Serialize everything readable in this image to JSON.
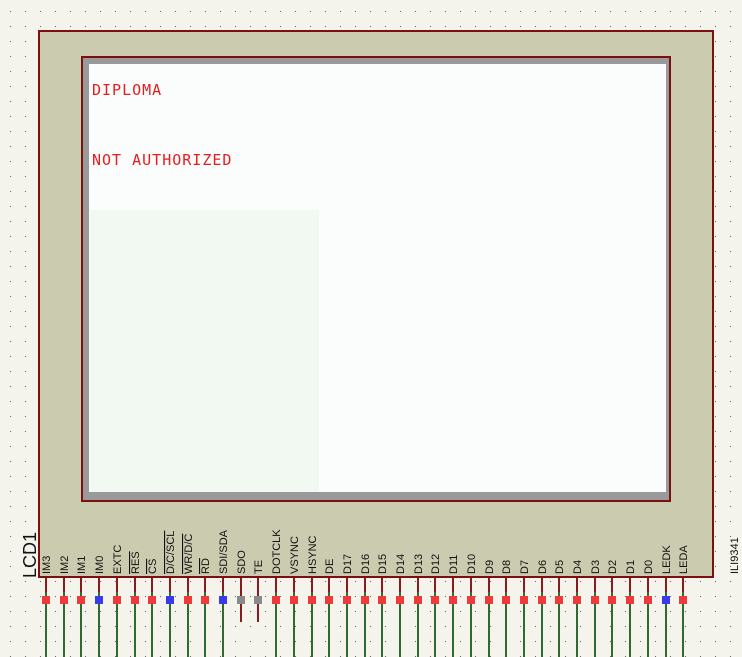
{
  "component": {
    "designator": "LCD1",
    "part_value": "ILI9341"
  },
  "display": {
    "lines": [
      "DIPLOMA",
      "NOT AUTHORIZED"
    ]
  },
  "pins": [
    {
      "name": "IM3",
      "state": "red"
    },
    {
      "name": "IM2",
      "state": "red"
    },
    {
      "name": "IM1",
      "state": "red"
    },
    {
      "name": "IM0",
      "state": "blue"
    },
    {
      "name": "EXTC",
      "state": "red"
    },
    {
      "name": "RES",
      "state": "red",
      "overline": true
    },
    {
      "name": "CS",
      "state": "red",
      "overline": true
    },
    {
      "name": "D/C/SCL",
      "state": "blue",
      "overline": true
    },
    {
      "name": "WR/D/C",
      "state": "red",
      "overline": true
    },
    {
      "name": "RD",
      "state": "red",
      "overline": true
    },
    {
      "name": "SDI/SDA",
      "state": "blue"
    },
    {
      "name": "SDO",
      "state": "gray"
    },
    {
      "name": "TE",
      "state": "gray"
    },
    {
      "name": "DOTCLK",
      "state": "red"
    },
    {
      "name": "VSYNC",
      "state": "red"
    },
    {
      "name": "HSYNC",
      "state": "red"
    },
    {
      "name": "DE",
      "state": "red"
    },
    {
      "name": "D17",
      "state": "red"
    },
    {
      "name": "D16",
      "state": "red"
    },
    {
      "name": "D15",
      "state": "red"
    },
    {
      "name": "D14",
      "state": "red"
    },
    {
      "name": "D13",
      "state": "red"
    },
    {
      "name": "D12",
      "state": "red"
    },
    {
      "name": "D11",
      "state": "red"
    },
    {
      "name": "D10",
      "state": "red"
    },
    {
      "name": "D9",
      "state": "red"
    },
    {
      "name": "D8",
      "state": "red"
    },
    {
      "name": "D7",
      "state": "red"
    },
    {
      "name": "D6",
      "state": "red"
    },
    {
      "name": "D5",
      "state": "red"
    },
    {
      "name": "D4",
      "state": "red"
    },
    {
      "name": "D3",
      "state": "red"
    },
    {
      "name": "D2",
      "state": "red"
    },
    {
      "name": "D1",
      "state": "red"
    },
    {
      "name": "D0",
      "state": "red"
    },
    {
      "name": "LEDK",
      "state": "blue"
    },
    {
      "name": "LEDA",
      "state": "red"
    }
  ],
  "colors": {
    "red": "#ee3a3a",
    "blue": "#3a3ae8",
    "gray": "#8a8a8a",
    "wire_green": "#2f6b2f",
    "wire_red": "#8b1a1a"
  }
}
